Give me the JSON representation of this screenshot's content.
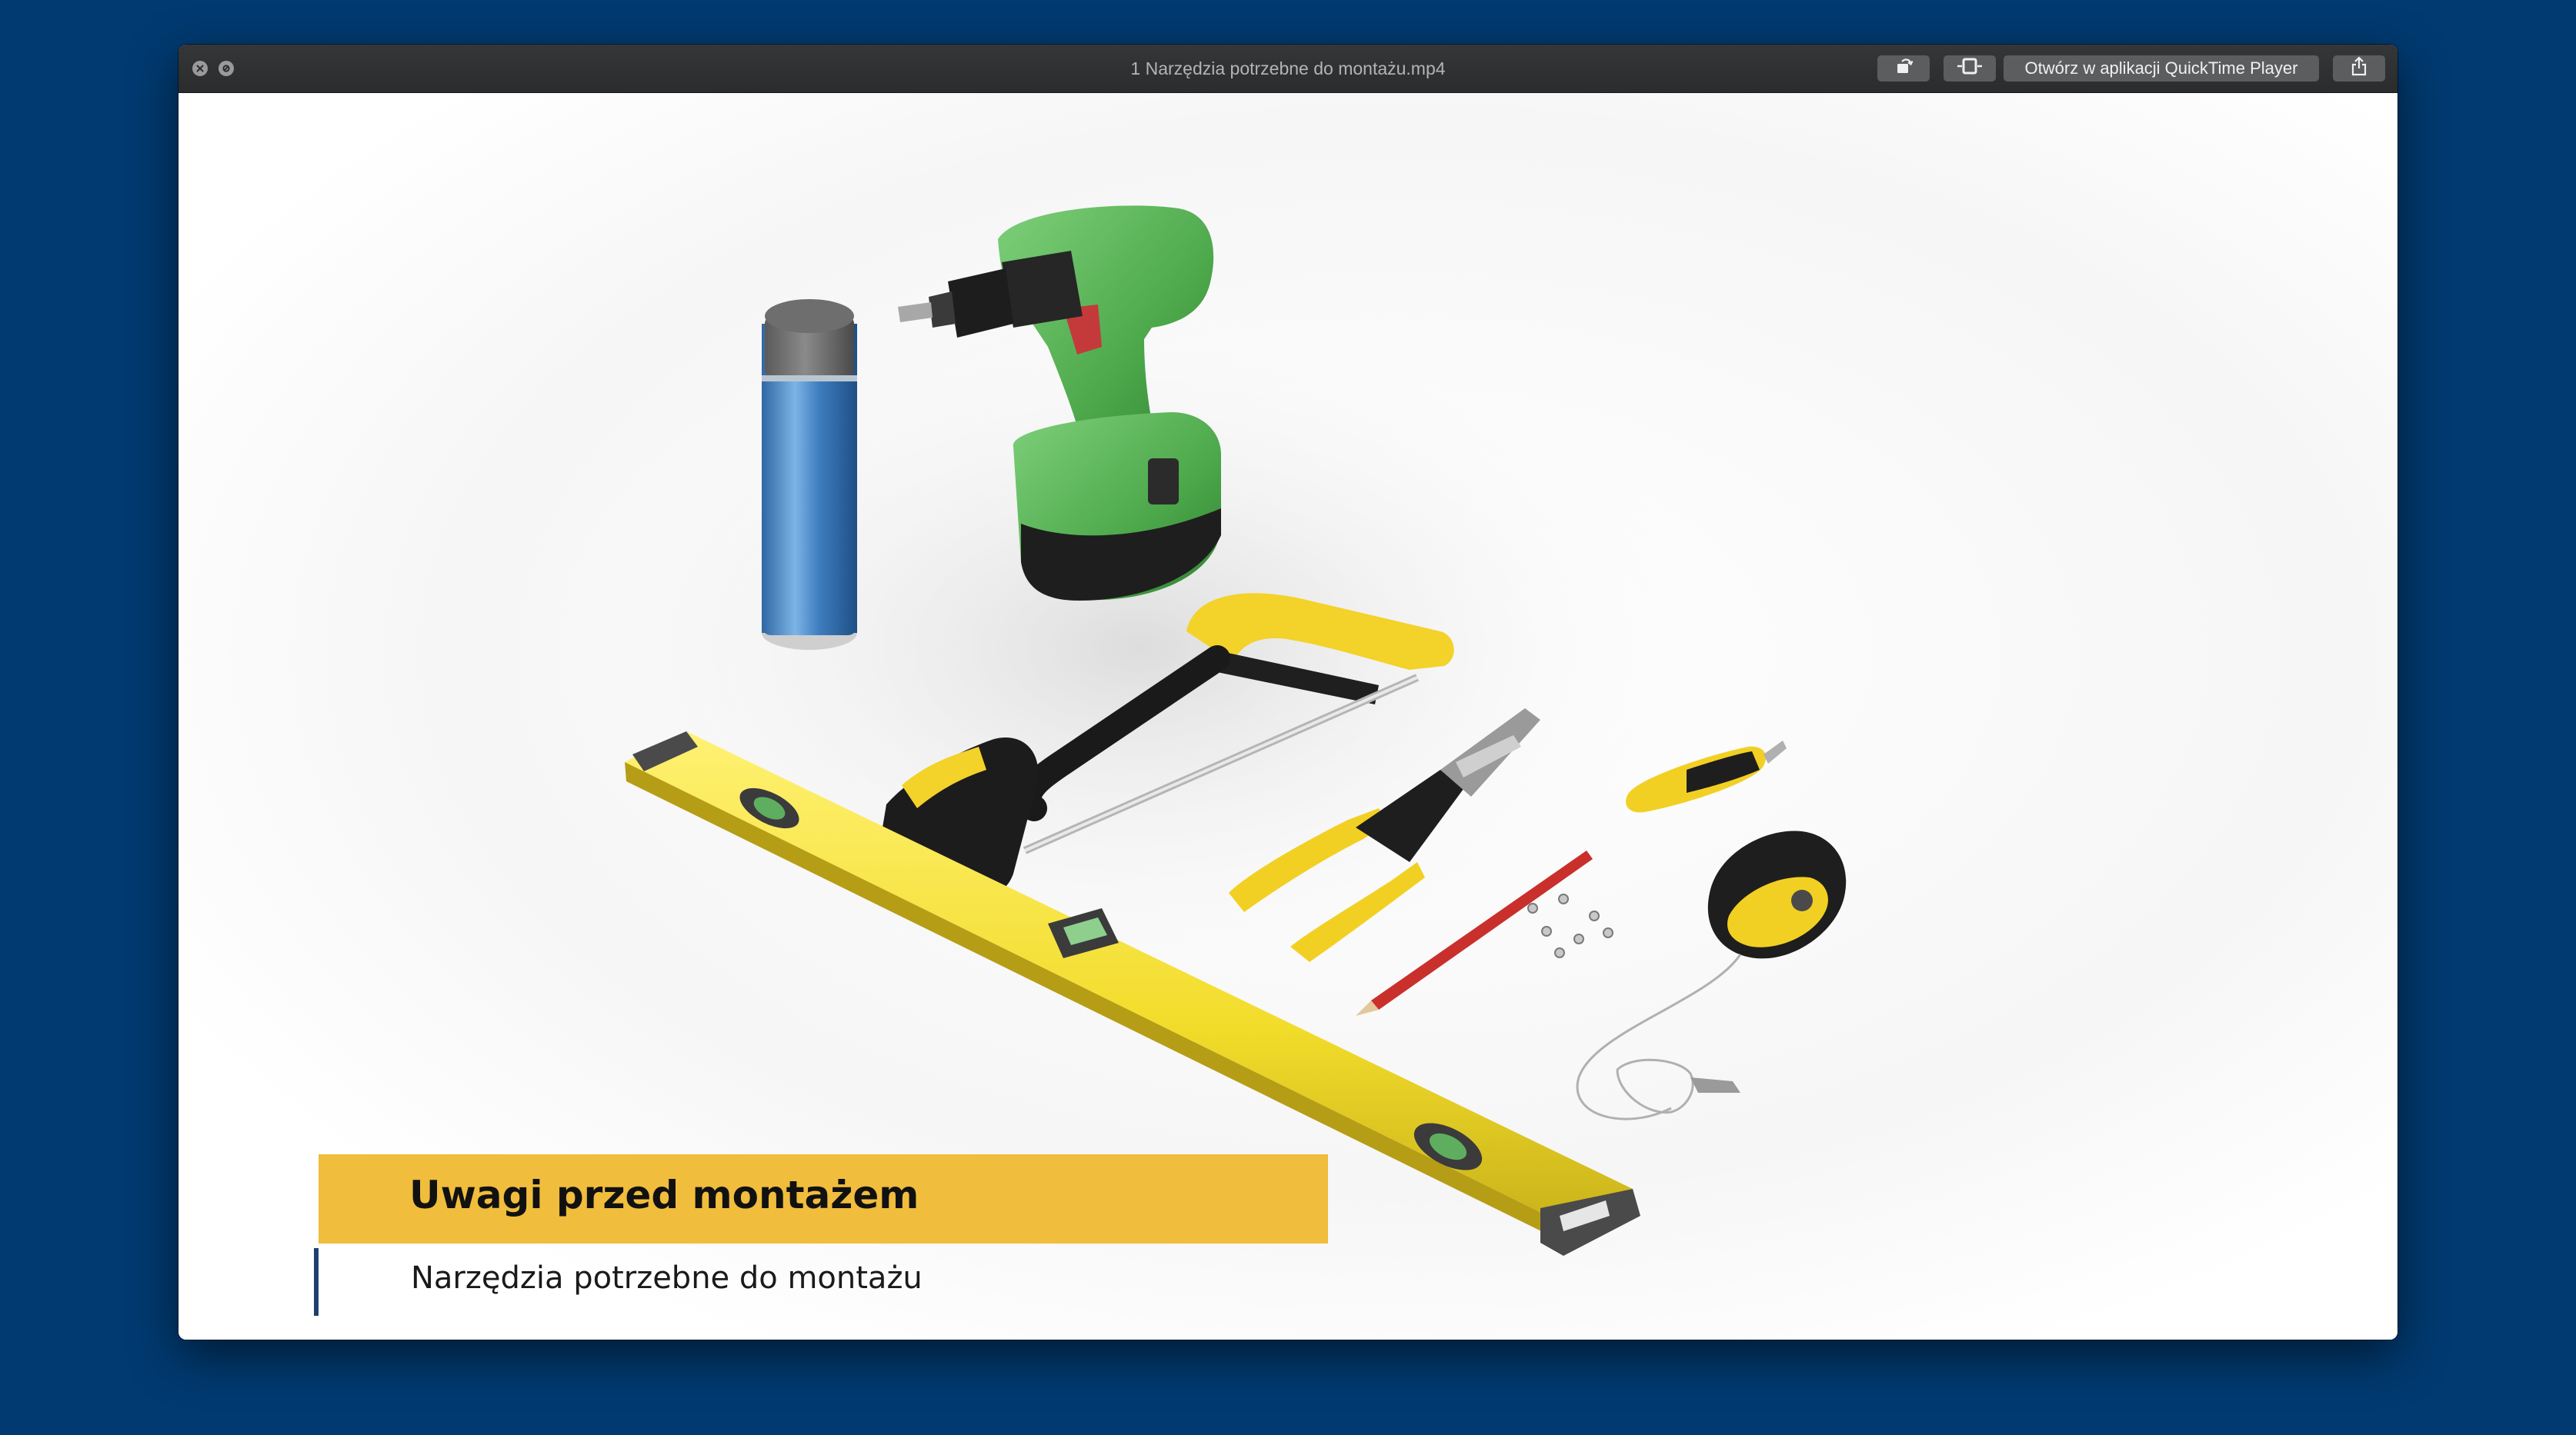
{
  "window": {
    "title": "1 Narzędzia potrzebne do montażu.mp4",
    "open_in_app_label": "Otwórz w aplikacji QuickTime Player"
  },
  "icons": {
    "close": "close-icon",
    "minimize": "minimize-icon",
    "rotate": "rotate-icon",
    "trim": "trim-icon",
    "share": "share-icon"
  },
  "video": {
    "overlay": {
      "title": "Uwagi przed montażem",
      "subtitle": "Narzędzia potrzebne do montażu"
    }
  },
  "colors": {
    "desktop_background": "#003a70",
    "overlay_bar": "#f0bd3c",
    "overlay_accent": "#1f3f70",
    "titlebar": "#2e2f31"
  }
}
